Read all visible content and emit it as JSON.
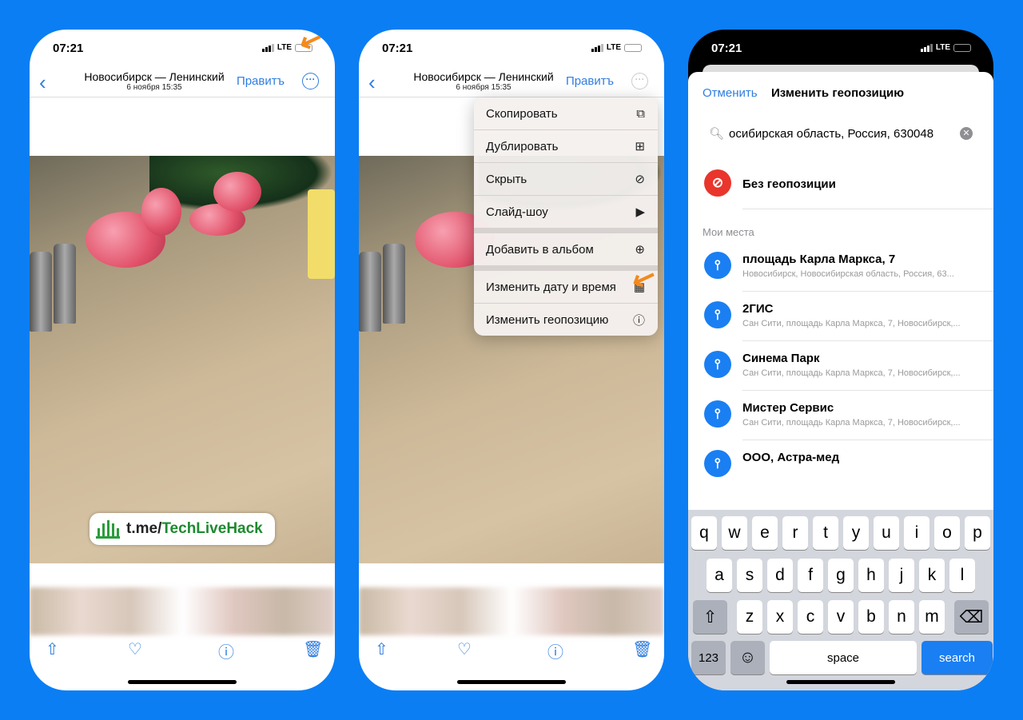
{
  "status": {
    "time": "07:21",
    "network": "LTE"
  },
  "viewer": {
    "title": "Новосибирск — Ленинский",
    "subtitle": "6 ноября  15:35",
    "edit": "Правитъ",
    "watermark_prefix": "t.me/",
    "watermark_brand": "TechLiveHack"
  },
  "menu": {
    "items": [
      {
        "label": "Скопировать",
        "icon": "copy-icon",
        "glyph": "⧉"
      },
      {
        "label": "Дублировать",
        "icon": "duplicate-icon",
        "glyph": "⊞"
      },
      {
        "label": "Скрыть",
        "icon": "eye-slash-icon",
        "glyph": "⊘"
      },
      {
        "label": "Слайд-шоу",
        "icon": "play-icon",
        "glyph": "▶"
      },
      {
        "label": "Добавить в альбом",
        "icon": "add-album-icon",
        "glyph": "⊕"
      },
      {
        "label": "Изменить дату и время",
        "icon": "calendar-icon",
        "glyph": "▦"
      },
      {
        "label": "Изменить геопозицию",
        "icon": "location-icon",
        "glyph": "ⓘ"
      }
    ]
  },
  "geo": {
    "cancel": "Отменить",
    "title": "Изменить геопозицию",
    "search_value": "осибирская область, Россия, 630048",
    "no_location": "Без геопозиции",
    "section": "Мои места",
    "places": [
      {
        "name": "площадь Карла Маркса, 7",
        "address": "Новосибирск, Новосибирская область, Россия, 63..."
      },
      {
        "name": "2ГИС",
        "address": "Сан Сити, площадь Карла Маркса, 7, Новосибирск,..."
      },
      {
        "name": "Синема Парк",
        "address": "Сан Сити, площадь Карла Маркса, 7, Новосибирск,..."
      },
      {
        "name": "Мистер Сервис",
        "address": "Сан Сити, площадь Карла Маркса, 7, Новосибирск,..."
      },
      {
        "name": "ООО, Астра-мед",
        "address": ""
      }
    ]
  },
  "keyboard": {
    "row1": [
      "q",
      "w",
      "e",
      "r",
      "t",
      "y",
      "u",
      "i",
      "o",
      "p"
    ],
    "row2": [
      "a",
      "s",
      "d",
      "f",
      "g",
      "h",
      "j",
      "k",
      "l"
    ],
    "row3": [
      "z",
      "x",
      "c",
      "v",
      "b",
      "n",
      "m"
    ],
    "numbers": "123",
    "space": "space",
    "search": "search"
  },
  "colors": {
    "background": "#0b7ef4",
    "accent": "#2f7de1",
    "arrow": "#f28a1e",
    "no_location": "#e9352b"
  }
}
